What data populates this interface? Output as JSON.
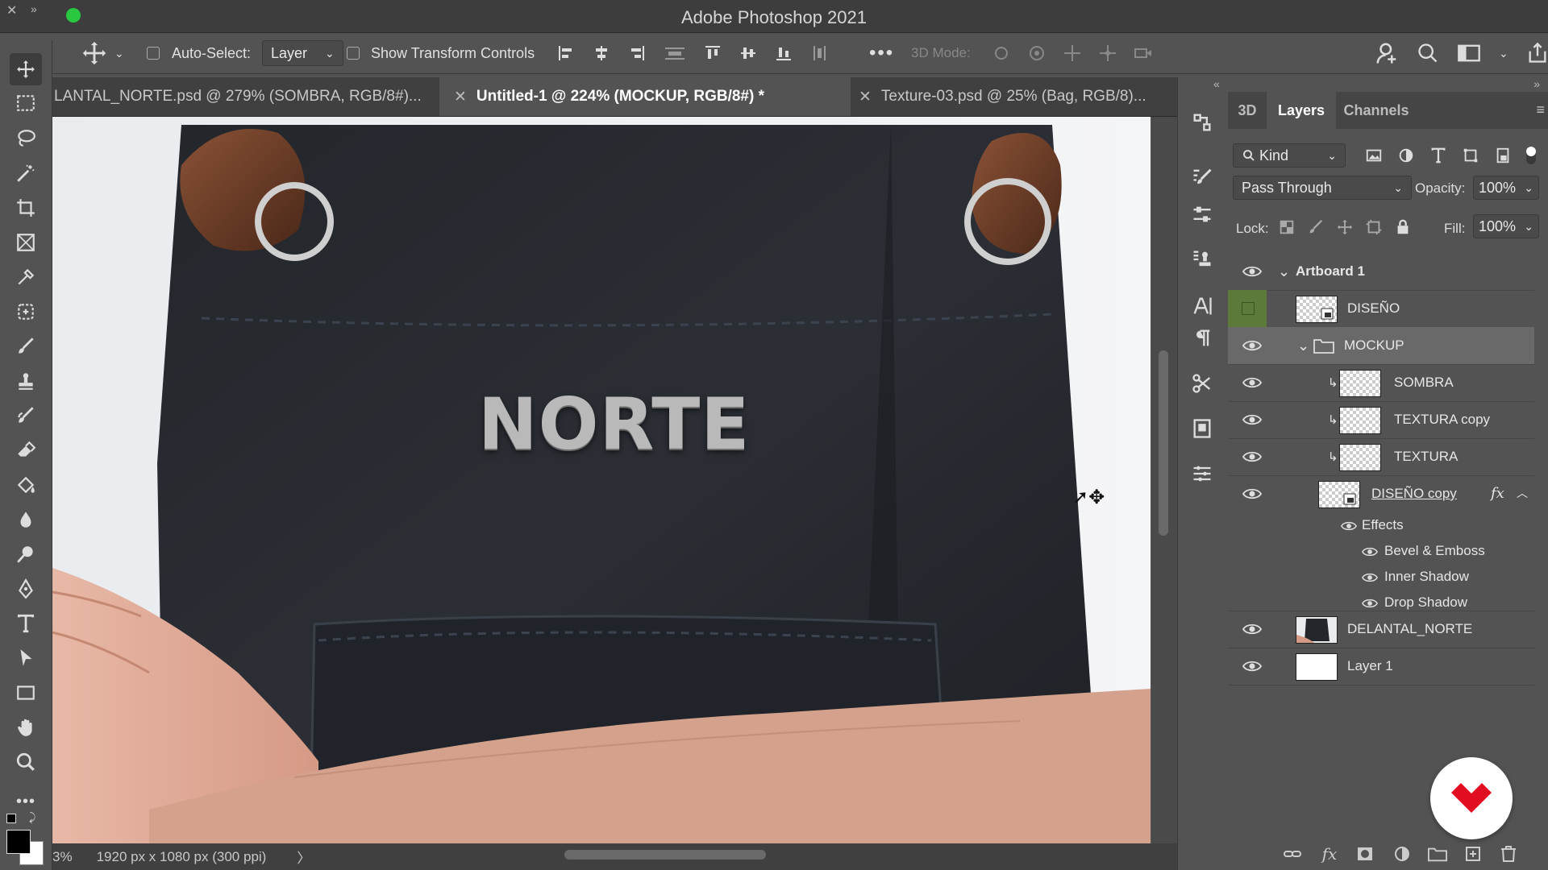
{
  "window": {
    "title": "Adobe Photoshop 2021"
  },
  "options_bar": {
    "auto_select_label": "Auto-Select:",
    "auto_select_value": "Layer",
    "show_transform_label": "Show Transform Controls",
    "three_d_mode_label": "3D Mode:"
  },
  "tabs": [
    {
      "label": "LANTAL_NORTE.psd @ 279% (SOMBRA, RGB/8#)..."
    },
    {
      "label": "Untitled-1 @ 224% (MOCKUP, RGB/8#) *"
    },
    {
      "label": "Texture-03.psd @ 25% (Bag, RGB/8)..."
    }
  ],
  "canvas": {
    "headline": "NORTE"
  },
  "status": {
    "zoom": "3%",
    "doc_info": "1920 px x 1080 px (300 ppi)"
  },
  "layers_panel": {
    "tabs": [
      "3D",
      "Layers",
      "Channels"
    ],
    "filter_kind": "Kind",
    "blend_mode": "Pass Through",
    "opacity_label": "Opacity:",
    "opacity_value": "100%",
    "lock_label": "Lock:",
    "fill_label": "Fill:",
    "fill_value": "100%",
    "artboard": "Artboard 1",
    "layers": [
      {
        "name": "DISEÑO"
      },
      {
        "name": "MOCKUP"
      },
      {
        "name": "SOMBRA"
      },
      {
        "name": "TEXTURA copy"
      },
      {
        "name": "TEXTURA"
      },
      {
        "name": "DISEÑO copy"
      },
      {
        "name": "DELANTAL_NORTE"
      },
      {
        "name": "Layer 1"
      }
    ],
    "effects_label": "Effects",
    "effects": [
      "Bevel & Emboss",
      "Inner Shadow",
      "Drop Shadow"
    ],
    "fx_label": "fx"
  },
  "colors": {
    "accent_green": "#28c840",
    "brand_red": "#e10d20",
    "panel_selected": "#696969"
  }
}
